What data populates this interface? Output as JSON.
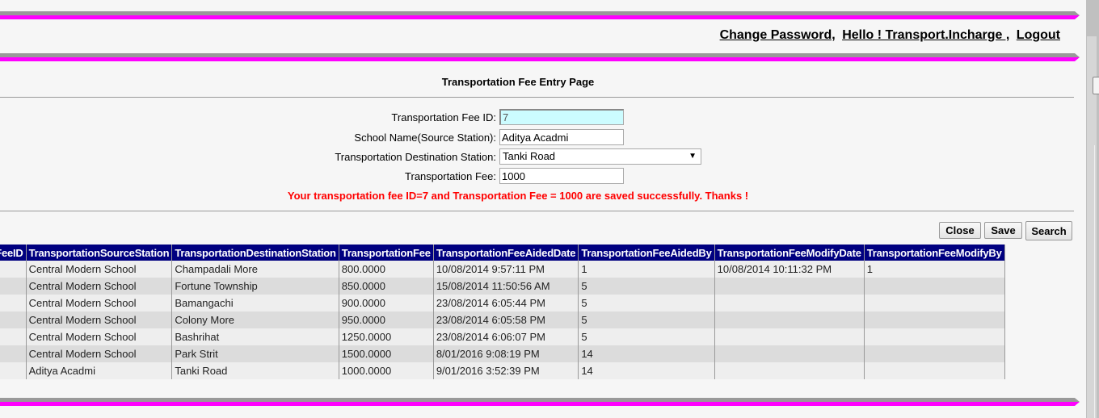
{
  "header": {
    "change_password": "Change Password,",
    "greeting": "Hello ! Transport.Incharge ,",
    "logout": "Logout"
  },
  "page_title": "Transportation Fee Entry Page",
  "form": {
    "fee_id": {
      "label": "Transportation Fee ID:",
      "value": "7"
    },
    "school_name": {
      "label": "School Name(Source Station):",
      "value": "Aditya Acadmi"
    },
    "destination": {
      "label": "Transportation Destination Station:",
      "selected": "Tanki Road",
      "arrow": "▼"
    },
    "fee": {
      "label": "Transportation Fee:",
      "value": "1000"
    }
  },
  "message": "Your transportation fee ID=7 and Transportation Fee = 1000 are saved successfully. Thanks !",
  "buttons": {
    "close": "Close",
    "save": "Save",
    "search": "Search"
  },
  "colors": {
    "accent_pink": "#ff00ff",
    "header_navy": "#000080",
    "message_red": "#ff0000",
    "id_field_bg": "#ccfcff"
  },
  "table": {
    "columns": [
      "TransportationFeeID",
      "TransportationSourceStation",
      "TransportationDestinationStation",
      "TransportationFee",
      "TransportationFeeAidedDate",
      "TransportationFeeAidedBy",
      "TransportationFeeModifyDate",
      "TransportationFeeModifyBy"
    ],
    "rows": [
      [
        "",
        "Central Modern School",
        "Champadali More",
        "800.0000",
        "10/08/2014 9:57:11 PM",
        "1",
        "10/08/2014 10:11:32 PM",
        "1"
      ],
      [
        "",
        "Central Modern School",
        "Fortune Township",
        "850.0000",
        "15/08/2014 11:50:56 AM",
        "5",
        "",
        ""
      ],
      [
        "",
        "Central Modern School",
        "Bamangachi",
        "900.0000",
        "23/08/2014 6:05:44 PM",
        "5",
        "",
        ""
      ],
      [
        "",
        "Central Modern School",
        "Colony More",
        "950.0000",
        "23/08/2014 6:05:58 PM",
        "5",
        "",
        ""
      ],
      [
        "",
        "Central Modern School",
        "Bashrihat",
        "1250.0000",
        "23/08/2014 6:06:07 PM",
        "5",
        "",
        ""
      ],
      [
        "",
        "Central Modern School",
        "Park Strit",
        "1500.0000",
        "8/01/2016 9:08:19 PM",
        "14",
        "",
        ""
      ],
      [
        "",
        "Aditya Acadmi",
        "Tanki Road",
        "1000.0000",
        "9/01/2016 3:52:39 PM",
        "14",
        "",
        ""
      ]
    ]
  }
}
